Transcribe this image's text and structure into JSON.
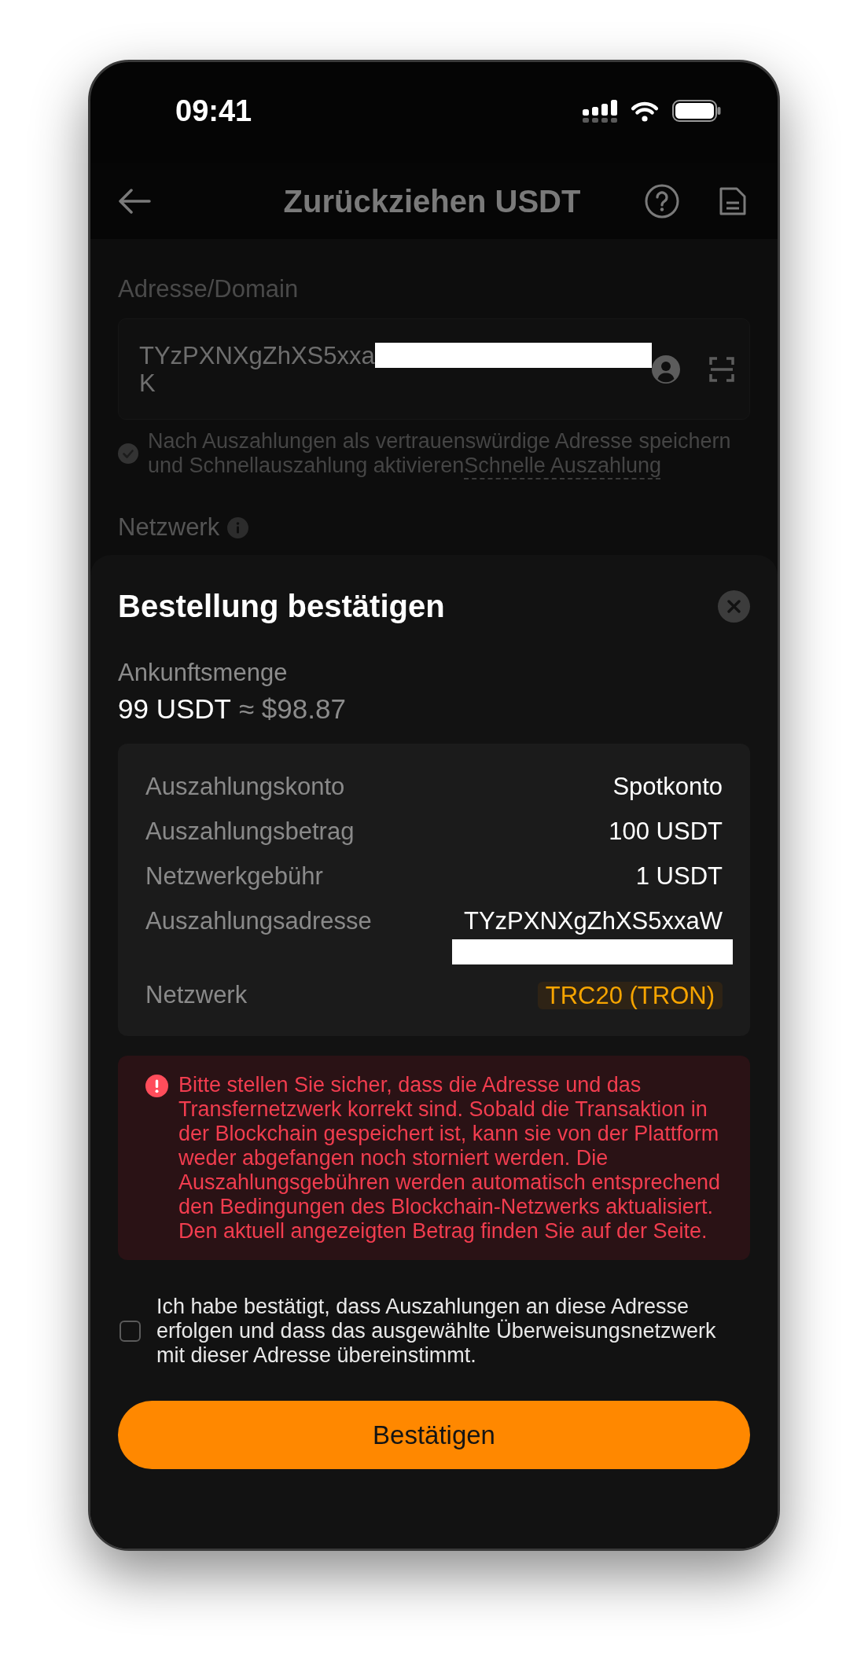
{
  "status_bar": {
    "time": "09:41"
  },
  "header": {
    "title": "Zurückziehen USDT"
  },
  "address": {
    "label": "Adresse/Domain",
    "value_start": "TYzPXNXgZhXS5xxa",
    "value_end": "K"
  },
  "save_option": {
    "checked": false,
    "text": "Nach Auszahlungen als vertrauenswürdige Adresse speichern und Schnellauszahlung aktivieren",
    "link": "Schnelle Auszahlung"
  },
  "network": {
    "label": "Netzwerk"
  },
  "dialog": {
    "title": "Bestellung bestätigen",
    "arrival": {
      "label": "Ankunftsmenge",
      "amount": "99 USDT",
      "approx": "≈ $98.87"
    },
    "details": [
      {
        "kind": "text",
        "label": "Auszahlungskonto",
        "value": "Spotkonto"
      },
      {
        "kind": "text",
        "label": "Auszahlungsbetrag",
        "value": "100 USDT"
      },
      {
        "kind": "text",
        "label": "Netzwerkgebühr",
        "value": "1 USDT"
      },
      {
        "kind": "address",
        "label": "Auszahlungsadresse",
        "value": "TYzPXNXgZhXS5xxaW"
      },
      {
        "kind": "tag",
        "label": "Netzwerk",
        "value": "TRC20 (TRON)"
      }
    ],
    "warning": "Bitte stellen Sie sicher, dass die Adresse und das Transfernetzwerk korrekt sind. Sobald die Transaktion in der Blockchain gespeichert ist, kann sie von der Plattform weder abgefangen noch storniert werden. Die Auszahlungsgebühren werden automatisch entsprechend den Bedingungen des Blockchain-Netzwerks aktualisiert. Den aktuell angezeigten Betrag finden Sie auf der Seite.",
    "agreement": {
      "checked": false,
      "text": "Ich habe bestätigt, dass Auszahlungen an diese Adresse erfolgen und dass das ausgewählte Überweisungsnetzwerk mit dieser Adresse übereinstimmt."
    },
    "confirm_button": "Bestätigen"
  }
}
